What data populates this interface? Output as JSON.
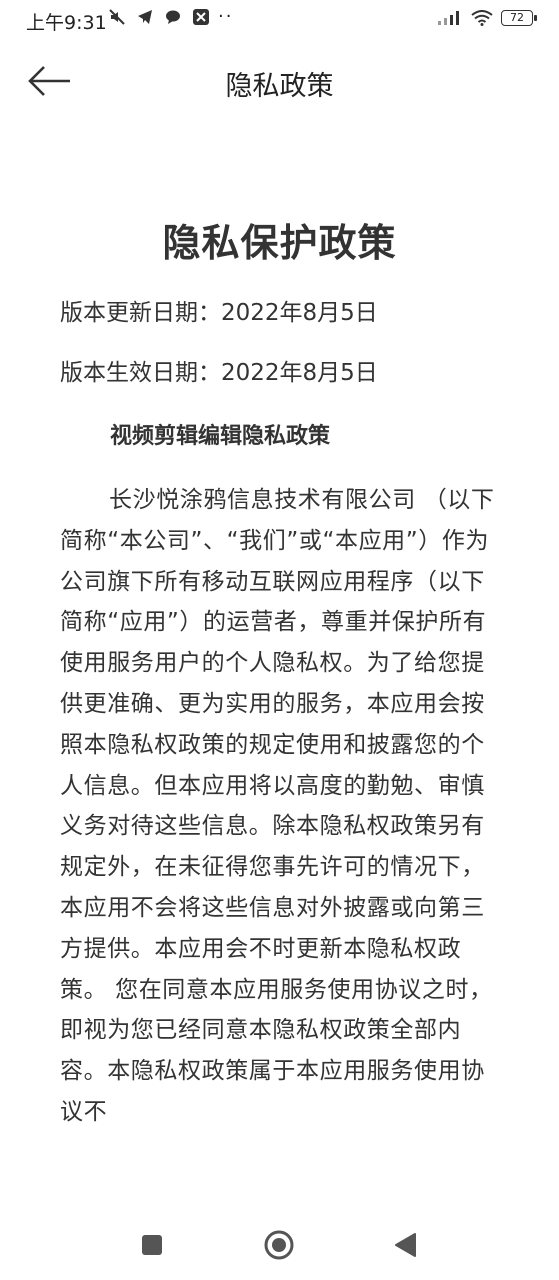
{
  "status_bar": {
    "time": "上午9:31",
    "dots": "··",
    "battery": "72"
  },
  "header": {
    "title": "隐私政策"
  },
  "document": {
    "title": "隐私保护政策",
    "updated": "版本更新日期：2022年8月5日",
    "effective": "版本生效日期：2022年8月5日",
    "subheading": "视频剪辑编辑隐私政策",
    "paragraph": "长沙悦涂鸦信息技术有限公司 （以下简称“本公司”、“我们”或“本应用”）作为公司旗下所有移动互联网应用程序（以下简称“应用”）的运营者，尊重并保护所有使用服务用户的个人隐私权。为了给您提供更准确、更为实用的服务，本应用会按照本隐私权政策的规定使用和披露您的个人信息。但本应用将以高度的勤勉、审慎义务对待这些信息。除本隐私权政策另有规定外，在未征得您事先许可的情况下，本应用不会将这些信息对外披露或向第三方提供。本应用会不时更新本隐私权政策。 您在同意本应用服务使用协议之时，即视为您已经同意本隐私权政策全部内容。本隐私权政策属于本应用服务使用协议不"
  },
  "colors": {
    "text": "#333333",
    "background": "#ffffff",
    "nav_icon": "#555555"
  }
}
